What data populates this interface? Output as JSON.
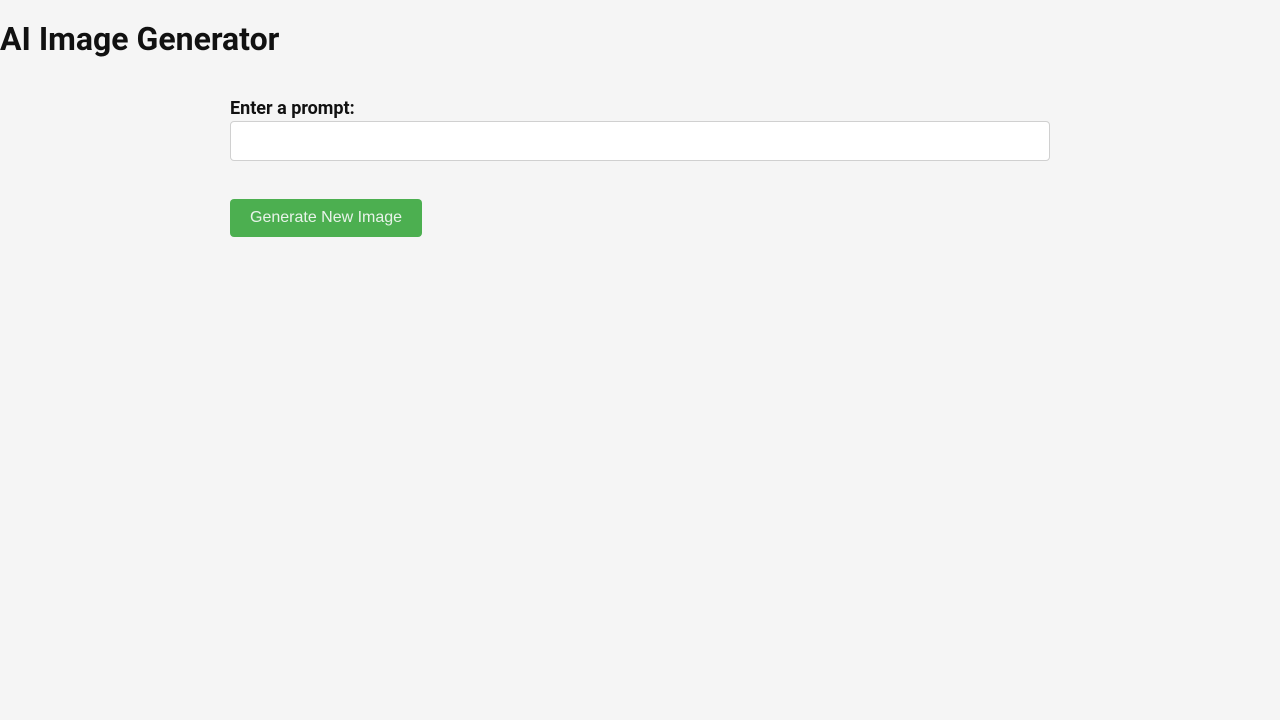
{
  "header": {
    "title": "AI Image Generator"
  },
  "form": {
    "prompt_label": "Enter a prompt:",
    "prompt_value": "",
    "prompt_placeholder": "",
    "generate_button_label": "Generate New Image"
  },
  "colors": {
    "background": "#f5f5f5",
    "button_bg": "#4caf50",
    "button_text": "#e8f3e9",
    "input_border": "#d0d0d0"
  }
}
